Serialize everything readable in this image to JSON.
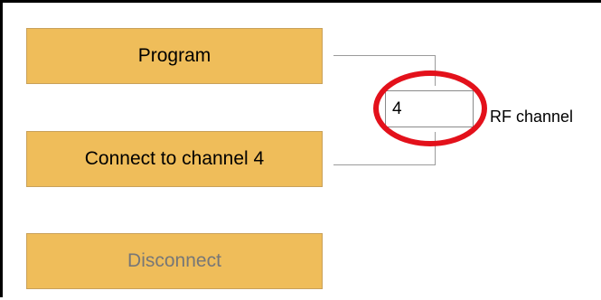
{
  "buttons": {
    "program_label": "Program",
    "connect_label": "Connect to channel 4",
    "disconnect_label": "Disconnect"
  },
  "rf_channel": {
    "value": "4",
    "label": "RF channel"
  },
  "colors": {
    "button_fill": "#efbd5a",
    "disabled_text": "#777777",
    "annotation_circle": "#e3111b"
  },
  "icons": {
    "spin_up": "triangle-up-icon",
    "spin_down": "triangle-down-icon"
  }
}
